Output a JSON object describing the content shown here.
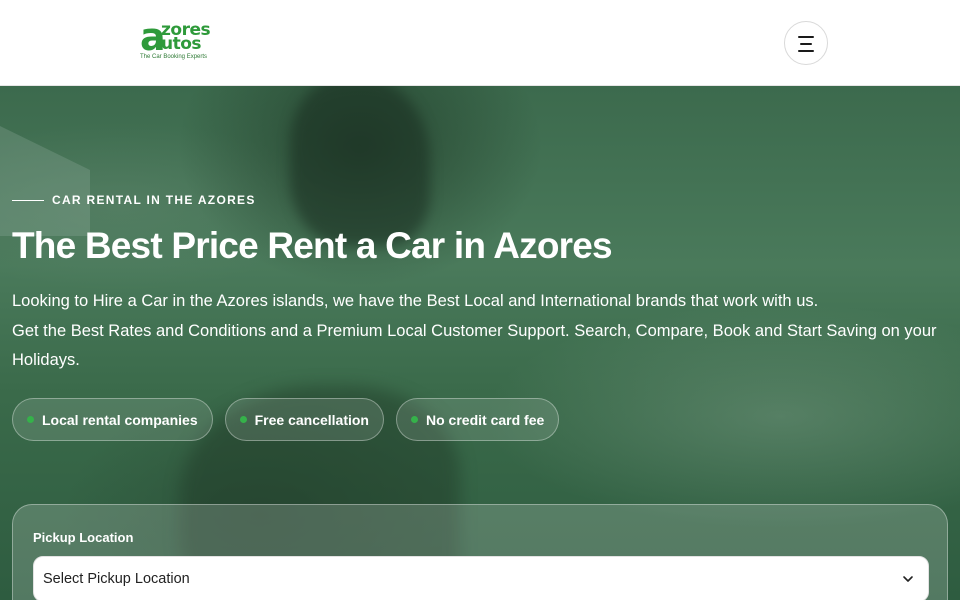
{
  "header": {
    "logo": {
      "letter": "a",
      "line1": "zores",
      "line2": "utos",
      "tagline": "The Car Booking Experts"
    },
    "menu_icon": "hamburger-menu-icon"
  },
  "hero": {
    "eyebrow": "CAR RENTAL IN THE AZORES",
    "title": "The Best Price Rent a Car in Azores",
    "description_line1": "Looking to Hire a Car in the Azores islands, we have the Best Local and International brands that work with us.",
    "description_line2": "Get the Best Rates and Conditions and a Premium Local Customer Support. Search, Compare, Book and Start Saving on your Holidays.",
    "badges": [
      {
        "label": "Local rental companies"
      },
      {
        "label": "Free cancellation"
      },
      {
        "label": "No credit card fee"
      }
    ]
  },
  "search": {
    "pickup_label": "Pickup Location",
    "pickup_value": "Select Pickup Location",
    "chevron_icon": "chevron-down-icon"
  },
  "colors": {
    "brand_green": "#2e9a3a",
    "badge_dot": "#35b24a",
    "hero_overlay": "#3c6a4d"
  }
}
